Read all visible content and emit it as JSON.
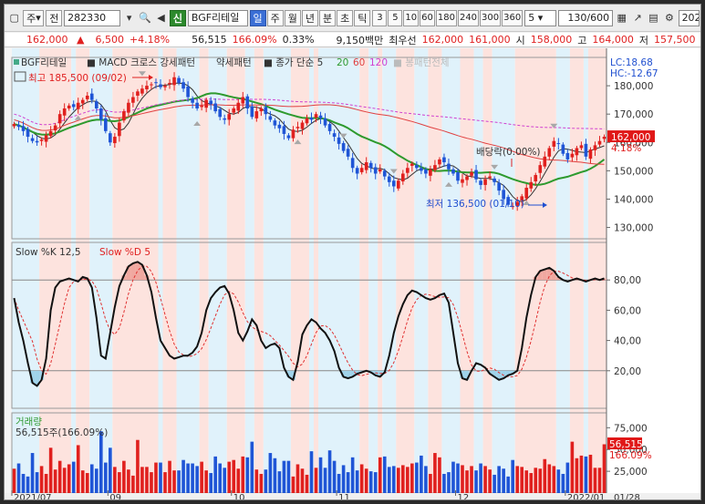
{
  "toolbar": {
    "code": "282330",
    "jeon": "전",
    "ju": "주",
    "badge": "신",
    "name": "BGF리테일",
    "periods": [
      "일",
      "주",
      "월",
      "년",
      "분",
      "초",
      "틱"
    ],
    "selected_period": "일",
    "ticks": [
      "3",
      "5",
      "10",
      "60",
      "180",
      "240",
      "300",
      "360"
    ],
    "interval": "5",
    "count": "130",
    "count_total": "/600",
    "right_value": "202"
  },
  "quote": {
    "price": "162,000",
    "arrow": "▲",
    "change": "6,500",
    "pct": "+4.18%",
    "volume": "56,515",
    "vol_ratio": "166.09%",
    "turnover": "0.33%",
    "amount": "9,150백만",
    "pref_label": "최우선",
    "ask": "162,000",
    "bid": "161,000",
    "open_label": "시",
    "open": "158,000",
    "high_label": "고",
    "high": "164,000",
    "low_label": "저",
    "low": "157,500"
  },
  "legend1": {
    "name": "BGF리테일",
    "items": [
      "MACD 크로스 강세패턴",
      "약세패턴",
      "종가 단순 5"
    ],
    "ma": [
      "20",
      "60",
      "120"
    ],
    "extra": "봉패턴전체"
  },
  "lc_text": "LC:18.68",
  "hc_text": "HC:-12.67",
  "max_text": "최고 185,500 (09/02)",
  "min_text": "최저 136,500 (01/10)",
  "div_text": "배당락(0.00%)",
  "price_tag": "162,000",
  "price_pct": "4.18%",
  "legend2": {
    "k": "Slow %K 12,5",
    "d": "Slow %D 5"
  },
  "legend3": {
    "name": "거래량",
    "value": "56,515주(166.09%)"
  },
  "vol_tag": "56,515",
  "vol_pct": "166.09%",
  "x_labels": [
    "2021/07",
    "09",
    "10",
    "11",
    "12",
    "2022/01",
    "01/28"
  ],
  "chart_data": [
    {
      "type": "candlestick",
      "y_ticks": [
        "180,000",
        "170,000",
        "160,000",
        "150,000",
        "140,000",
        "130,000"
      ],
      "ylim": [
        126000,
        190000
      ],
      "close": [
        166500,
        165500,
        164000,
        162000,
        160500,
        160000,
        161000,
        162500,
        164000,
        166000,
        170000,
        172000,
        173000,
        172500,
        174000,
        175000,
        176500,
        175000,
        172000,
        168000,
        164000,
        160000,
        162000,
        167000,
        171000,
        174000,
        176000,
        178000,
        179000,
        180000,
        180500,
        181000,
        179500,
        180000,
        181000,
        183000,
        181000,
        179000,
        176000,
        174000,
        172000,
        173000,
        175000,
        173500,
        171000,
        169000,
        168000,
        170000,
        172000,
        174000,
        176000,
        172000,
        169000,
        171000,
        172000,
        170000,
        168000,
        166000,
        165000,
        163000,
        161500,
        164500,
        165500,
        167000,
        168500,
        168000,
        170000,
        168500,
        166000,
        164000,
        162000,
        159500,
        157000,
        155000,
        151000,
        149000,
        151000,
        153000,
        151000,
        149000,
        150500,
        148000,
        146000,
        144500,
        146500,
        149000,
        151000,
        152500,
        151000,
        150000,
        149000,
        150500,
        152000,
        154000,
        153000,
        150500,
        149000,
        146500,
        147000,
        148000,
        149500,
        147000,
        145000,
        147000,
        148000,
        146000,
        143000,
        140000,
        138000,
        137500,
        139000,
        141000,
        144000,
        146000,
        148500,
        152000,
        155000,
        158000,
        160500,
        159500,
        156000,
        154000,
        156000,
        158000,
        159000,
        155000,
        157500,
        159000,
        160500,
        162000
      ]
    },
    {
      "type": "line",
      "name": "Slow %K 12,5",
      "y_ticks": [
        "80,00",
        "60,00",
        "40,00",
        "20,00"
      ],
      "ylim": [
        0,
        100
      ],
      "values": [
        68,
        52,
        40,
        25,
        12,
        10,
        14,
        28,
        60,
        75,
        79,
        80,
        81,
        80,
        79,
        82,
        81,
        75,
        55,
        30,
        28,
        45,
        62,
        76,
        83,
        89,
        91,
        92,
        90,
        83,
        72,
        55,
        40,
        35,
        30,
        28,
        29,
        30,
        30,
        32,
        36,
        45,
        60,
        68,
        72,
        75,
        76,
        71,
        60,
        45,
        40,
        46,
        54,
        50,
        40,
        35,
        37,
        38,
        35,
        22,
        16,
        14,
        26,
        44,
        50,
        54,
        52,
        48,
        45,
        40,
        33,
        22,
        16,
        15,
        16,
        18,
        19,
        20,
        19,
        17,
        16,
        19,
        30,
        45,
        56,
        64,
        70,
        73,
        72,
        70,
        68,
        67,
        68,
        70,
        71,
        65,
        45,
        25,
        15,
        14,
        20,
        25,
        24,
        22,
        18,
        16,
        14,
        15,
        17,
        18,
        20,
        35,
        55,
        70,
        82,
        86,
        87,
        88,
        86,
        82,
        80,
        79,
        80,
        81,
        80,
        79,
        80,
        81,
        80,
        81
      ]
    },
    {
      "type": "bar",
      "name": "거래량",
      "y_ticks": [
        "75,000",
        "50,000",
        "25,000"
      ],
      "ylim": [
        0,
        90000
      ],
      "values": [
        28,
        34,
        22,
        19,
        46,
        24,
        31,
        22,
        52,
        27,
        37,
        29,
        33,
        36,
        55,
        26,
        23,
        33,
        28,
        71,
        35,
        52,
        30,
        24,
        37,
        27,
        20,
        61,
        30,
        30,
        24,
        35,
        35,
        24,
        37,
        26,
        26,
        38,
        34,
        34,
        31,
        36,
        26,
        23,
        42,
        34,
        29,
        36,
        38,
        28,
        42,
        41,
        59,
        27,
        22,
        27,
        46,
        40,
        25,
        37,
        37,
        19,
        33,
        28,
        21,
        48,
        29,
        41,
        29,
        49,
        37,
        22,
        32,
        24,
        41,
        26,
        33,
        28,
        25,
        24,
        41,
        42,
        30,
        31,
        29,
        32,
        30,
        34,
        35,
        43,
        31,
        22,
        46,
        41,
        22,
        24,
        36,
        34,
        32,
        26,
        31,
        26,
        34,
        31,
        27,
        21,
        31,
        28,
        19,
        38,
        31,
        30,
        26,
        23,
        29,
        28,
        39,
        33,
        31,
        27,
        22,
        35,
        59,
        40,
        43,
        42,
        44,
        29,
        29,
        56
      ]
    }
  ]
}
